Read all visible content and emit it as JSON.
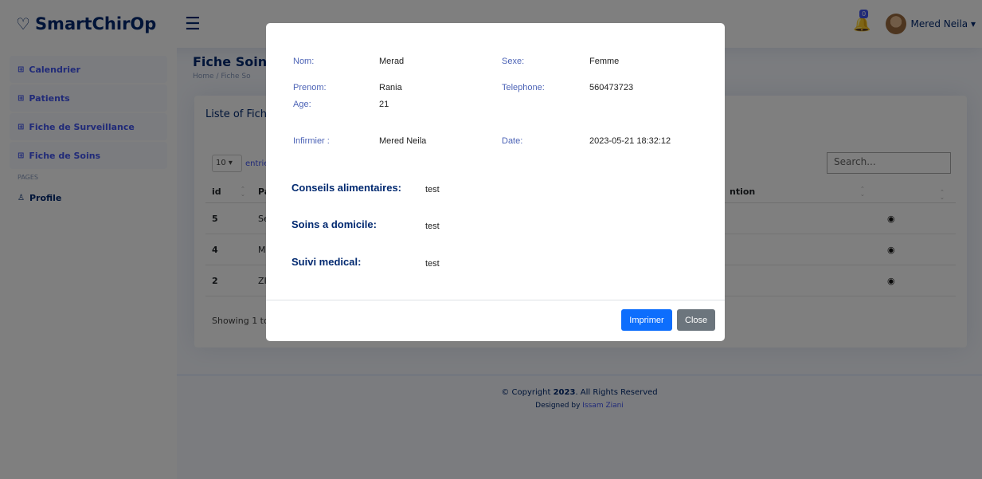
{
  "header": {
    "brand": "SmartChirOp",
    "notification_count": "0",
    "user_name": "Mered Neila ▾"
  },
  "sidebar": {
    "items": [
      {
        "label": "Calendrier"
      },
      {
        "label": "Patients"
      },
      {
        "label": "Fiche de Surveillance"
      },
      {
        "label": "Fiche de Soins"
      }
    ],
    "pages_heading": "PAGES",
    "profile_label": "Profile"
  },
  "main": {
    "title": "Fiche Soin",
    "breadcrumb": "Home / Fiche So",
    "card_title": "Liste of Fich",
    "length_value": "10 ▾",
    "length_suffix": "entrie",
    "search_placeholder": "Search...",
    "columns": {
      "id": "id",
      "patient": "Pa",
      "intervention": "ntion"
    },
    "rows": [
      {
        "id": "5",
        "patient": "Se"
      },
      {
        "id": "4",
        "patient": "M"
      },
      {
        "id": "2",
        "patient": "ZI"
      }
    ],
    "showing": "Showing 1 to"
  },
  "footer": {
    "copyright_prefix": "© Copyright ",
    "year": "2023",
    "copyright_suffix": ". All Rights Reserved",
    "designed_prefix": "Designed by ",
    "designer": "Issam Ziani"
  },
  "modal": {
    "nom_label": "Nom:",
    "nom": "Merad",
    "sexe_label": "Sexe:",
    "sexe": "Femme",
    "prenom_label": "Prenom:",
    "prenom": "Rania",
    "telephone_label": "Telephone:",
    "telephone": "560473723",
    "age_label": "Age:",
    "age": "21",
    "infirmier_label": "Infirmier :",
    "infirmier": "Mered Neila",
    "date_label": "Date:",
    "date": "2023-05-21 18:32:12",
    "conseils_label": "Conseils alimentaires:",
    "conseils": "test",
    "soins_label": "Soins a domicile:",
    "soins": "test",
    "suivi_label": "Suivi medical:",
    "suivi": "test",
    "print_label": "Imprimer",
    "close_label": "Close"
  }
}
